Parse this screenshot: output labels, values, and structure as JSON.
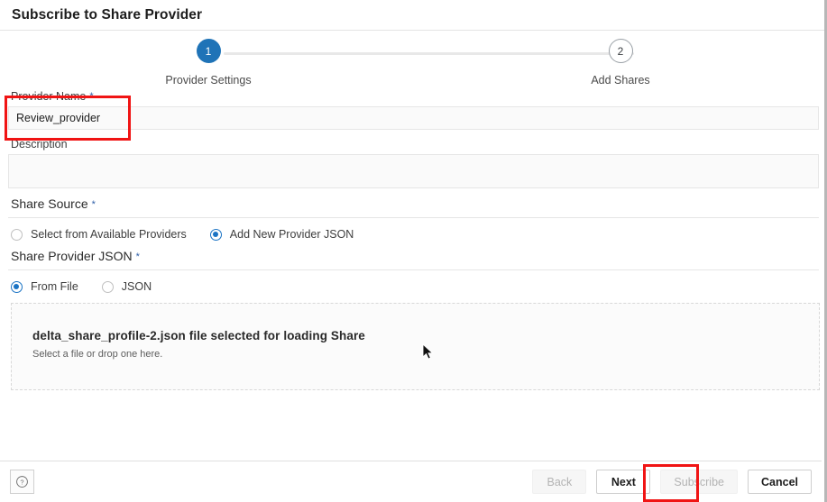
{
  "dialog": {
    "title": "Subscribe to Share Provider"
  },
  "stepper": {
    "steps": [
      {
        "number": "1",
        "label": "Provider Settings",
        "state": "active"
      },
      {
        "number": "2",
        "label": "Add Shares",
        "state": "inactive"
      }
    ]
  },
  "form": {
    "provider_name": {
      "label": "Provider Name",
      "required_marker": "*",
      "value": "Review_provider",
      "placeholder": ""
    },
    "description": {
      "label": "Description",
      "value": "",
      "placeholder": ""
    }
  },
  "share_source": {
    "title": "Share Source",
    "required_marker": "*",
    "options": [
      {
        "label": "Select from Available Providers",
        "selected": false
      },
      {
        "label": "Add New Provider JSON",
        "selected": true
      }
    ]
  },
  "share_provider_json": {
    "title": "Share Provider JSON",
    "required_marker": "*",
    "options": [
      {
        "label": "From File",
        "selected": true
      },
      {
        "label": "JSON",
        "selected": false
      }
    ],
    "dropzone": {
      "title": "delta_share_profile-2.json file selected for loading Share",
      "subtitle": "Select a file or drop one here."
    }
  },
  "footer": {
    "help_icon": "question-mark-circle-icon",
    "buttons": [
      {
        "label": "Back",
        "enabled": false
      },
      {
        "label": "Next",
        "enabled": true
      },
      {
        "label": "Subscribe",
        "enabled": false
      },
      {
        "label": "Cancel",
        "enabled": true
      }
    ]
  },
  "colors": {
    "accent_blue": "#1f73b7",
    "radio_blue": "#1a73c4",
    "annotation_red": "#f01414",
    "required_star": "#2f5fa8"
  }
}
